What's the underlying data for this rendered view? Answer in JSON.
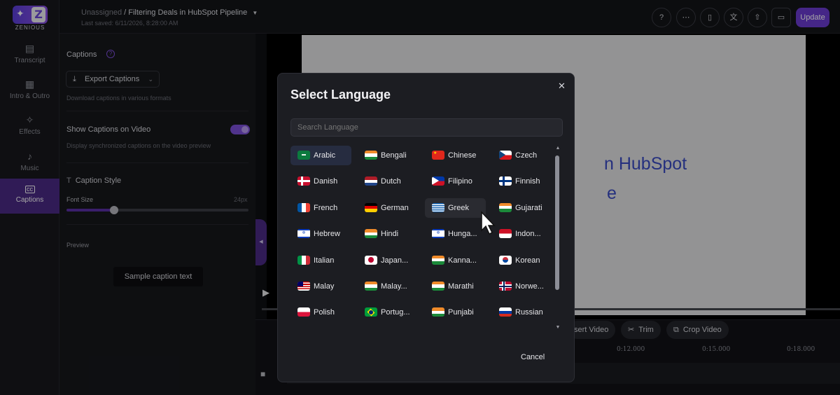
{
  "app": {
    "logo_text": "ZENIOUS",
    "breadcrumb_prefix": "Unassigned",
    "breadcrumb_sep": " / ",
    "title": "Filtering Deals in HubSpot Pipeline",
    "last_saved": "Last saved: 6/11/2026, 8:28:00 AM",
    "update_label": "Update"
  },
  "rail": [
    {
      "label": "Transcript",
      "icon": "transcript-icon"
    },
    {
      "label": "Intro & Outro",
      "icon": "film-icon"
    },
    {
      "label": "Effects",
      "icon": "sparkle-icon"
    },
    {
      "label": "Music",
      "icon": "music-note-icon"
    },
    {
      "label": "Captions",
      "icon": "cc-icon",
      "active": true
    }
  ],
  "panel": {
    "title": "Captions",
    "help": "?",
    "export_label": "Export Captions",
    "export_hint": "Download captions in various formats",
    "show_label": "Show Captions on Video",
    "show_hint": "Display synchronized captions on the video preview",
    "show_enabled": true,
    "caption_style": "Caption Style",
    "font_size_label": "Font Size",
    "font_size_value": "24px",
    "font_size_fraction": 0.26,
    "preview_label": "Preview",
    "sample": "Sample caption text"
  },
  "video": {
    "slide_line1": "n HubSpot",
    "slide_line2": "e"
  },
  "timeline": {
    "insert_label": "sert Video",
    "trim_label": "Trim",
    "crop_label": "Crop Video",
    "times": [
      "0:12.000",
      "0:15.000",
      "0:18.000"
    ]
  },
  "modal": {
    "title": "Select Language",
    "close": "✕",
    "search_placeholder": "Search Language",
    "cancel": "Cancel",
    "languages": [
      {
        "label": "Arabic",
        "flag": "sa",
        "state": "selected"
      },
      {
        "label": "Bengali",
        "flag": "in"
      },
      {
        "label": "Chinese",
        "flag": "cn"
      },
      {
        "label": "Czech",
        "flag": "cz"
      },
      {
        "label": "Danish",
        "flag": "dk"
      },
      {
        "label": "Dutch",
        "flag": "nl"
      },
      {
        "label": "Filipino",
        "flag": "ph"
      },
      {
        "label": "Finnish",
        "flag": "fi"
      },
      {
        "label": "French",
        "flag": "fr"
      },
      {
        "label": "German",
        "flag": "de"
      },
      {
        "label": "Greek",
        "flag": "gr",
        "state": "hover"
      },
      {
        "label": "Gujarati",
        "flag": "in"
      },
      {
        "label": "Hebrew",
        "flag": "il"
      },
      {
        "label": "Hindi",
        "flag": "in"
      },
      {
        "label": "Hunga...",
        "flag": "il"
      },
      {
        "label": "Indon...",
        "flag": "id"
      },
      {
        "label": "Italian",
        "flag": "it"
      },
      {
        "label": "Japan...",
        "flag": "jp"
      },
      {
        "label": "Kanna...",
        "flag": "in"
      },
      {
        "label": "Korean",
        "flag": "kr"
      },
      {
        "label": "Malay",
        "flag": "my"
      },
      {
        "label": "Malay...",
        "flag": "in"
      },
      {
        "label": "Marathi",
        "flag": "in"
      },
      {
        "label": "Norwe...",
        "flag": "no"
      },
      {
        "label": "Polish",
        "flag": "pl"
      },
      {
        "label": "Portug...",
        "flag": "br"
      },
      {
        "label": "Punjabi",
        "flag": "in"
      },
      {
        "label": "Russian",
        "flag": "ru"
      }
    ]
  }
}
